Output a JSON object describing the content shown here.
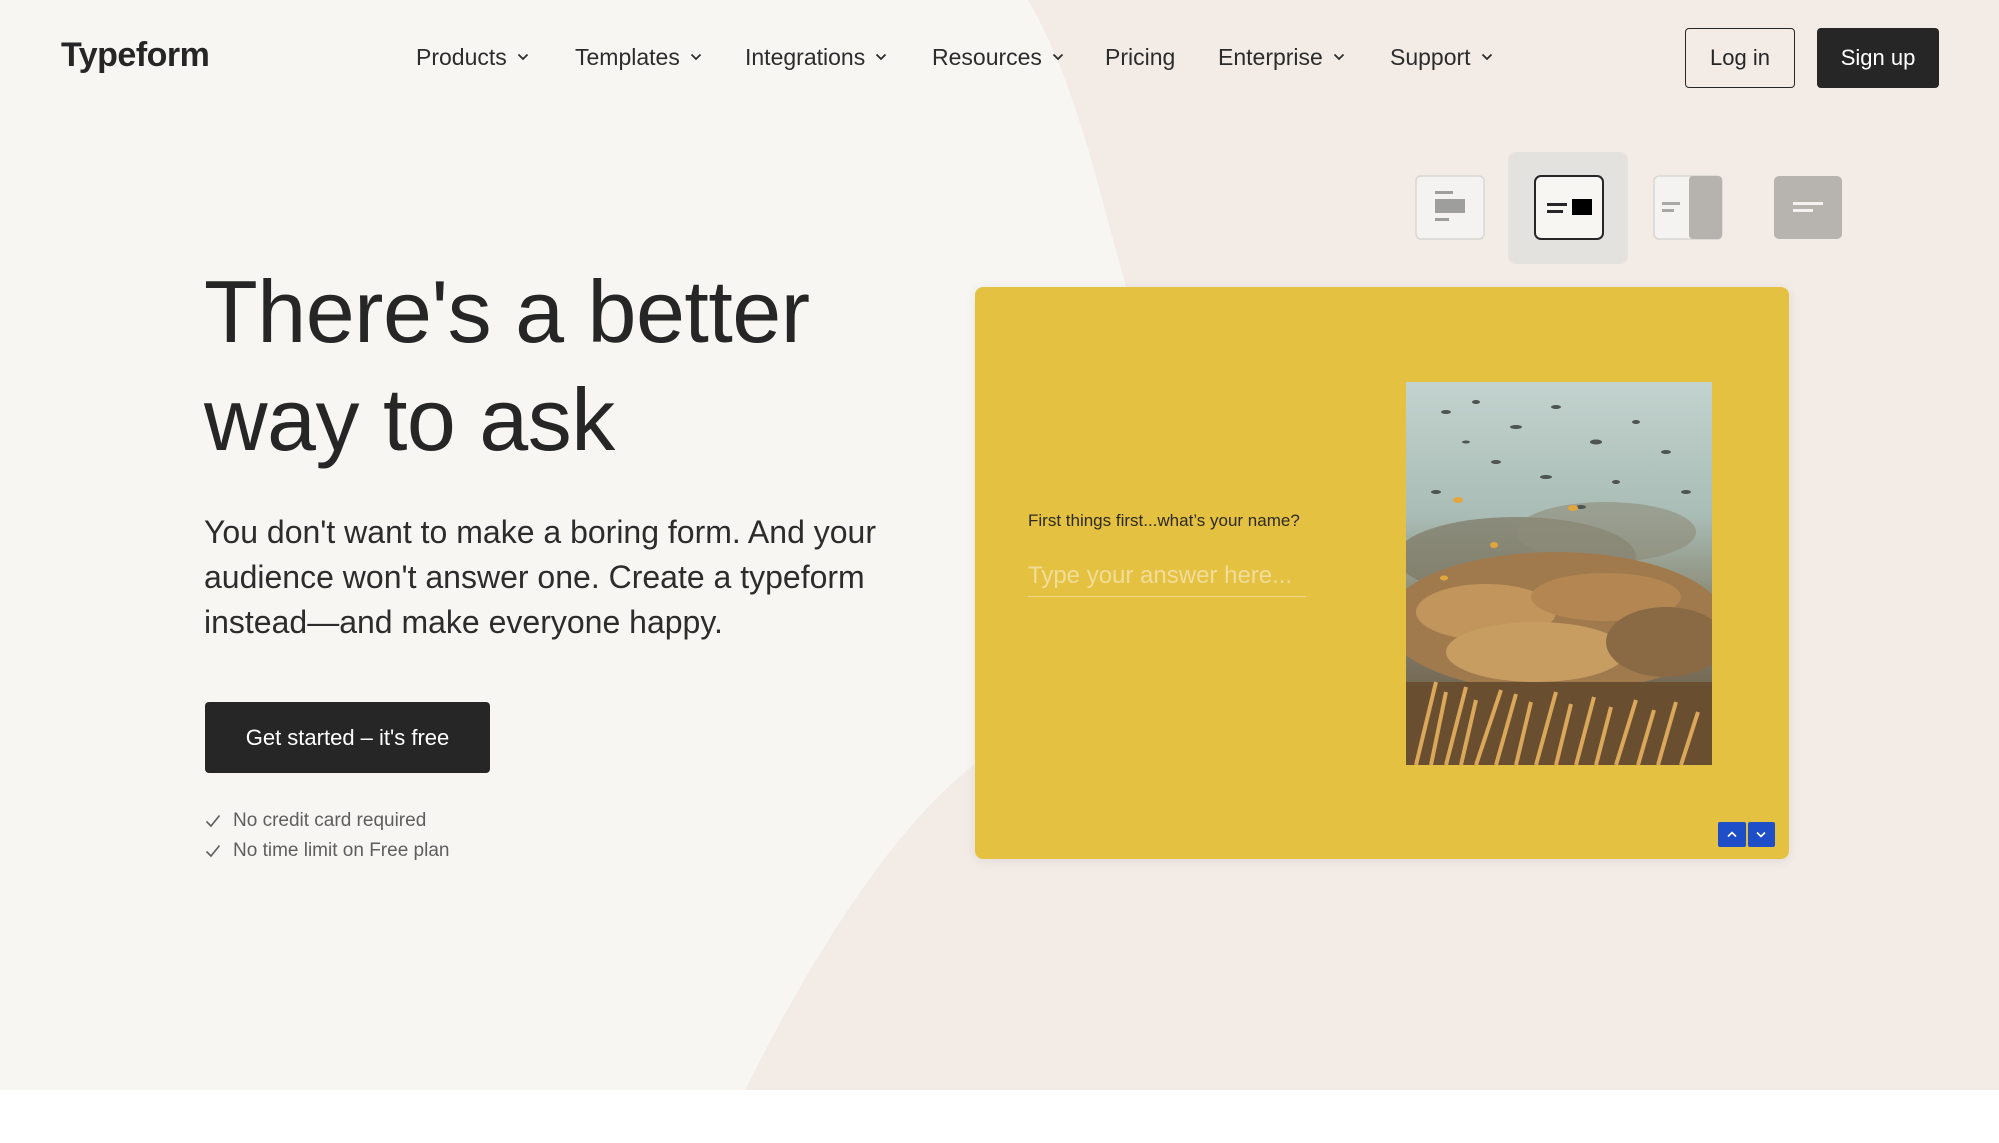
{
  "brand": {
    "name": "Typeform"
  },
  "nav": {
    "items": [
      {
        "label": "Products",
        "has_dropdown": true
      },
      {
        "label": "Templates",
        "has_dropdown": true
      },
      {
        "label": "Integrations",
        "has_dropdown": true
      },
      {
        "label": "Resources",
        "has_dropdown": true
      },
      {
        "label": "Pricing",
        "has_dropdown": false
      },
      {
        "label": "Enterprise",
        "has_dropdown": true
      },
      {
        "label": "Support",
        "has_dropdown": true
      }
    ],
    "login_label": "Log in",
    "signup_label": "Sign up"
  },
  "hero": {
    "headline_line1": "There's a better",
    "headline_line2": "way to ask",
    "subhead": "You don't want to make a boring form. And your audience won't answer one. Create a typeform instead—and make everyone happy.",
    "cta_label": "Get started – it's free",
    "perks": [
      "No credit card required",
      "No time limit on Free plan"
    ]
  },
  "layout_picker": {
    "options": [
      "layout-stack-icon",
      "layout-split-icon",
      "layout-side-panel-icon",
      "layout-wallpaper-icon"
    ],
    "active": "layout-split-icon"
  },
  "form_preview": {
    "question": "First things first...what’s your name?",
    "placeholder": "Type your answer here...",
    "image": "coral-reef-photo"
  },
  "colors": {
    "page_bg": "#f7f6f3",
    "accent_shape": "#f3ece6",
    "dark": "#262627",
    "form_yellow": "#e5c142",
    "arrow_blue": "#1f4fc8"
  }
}
